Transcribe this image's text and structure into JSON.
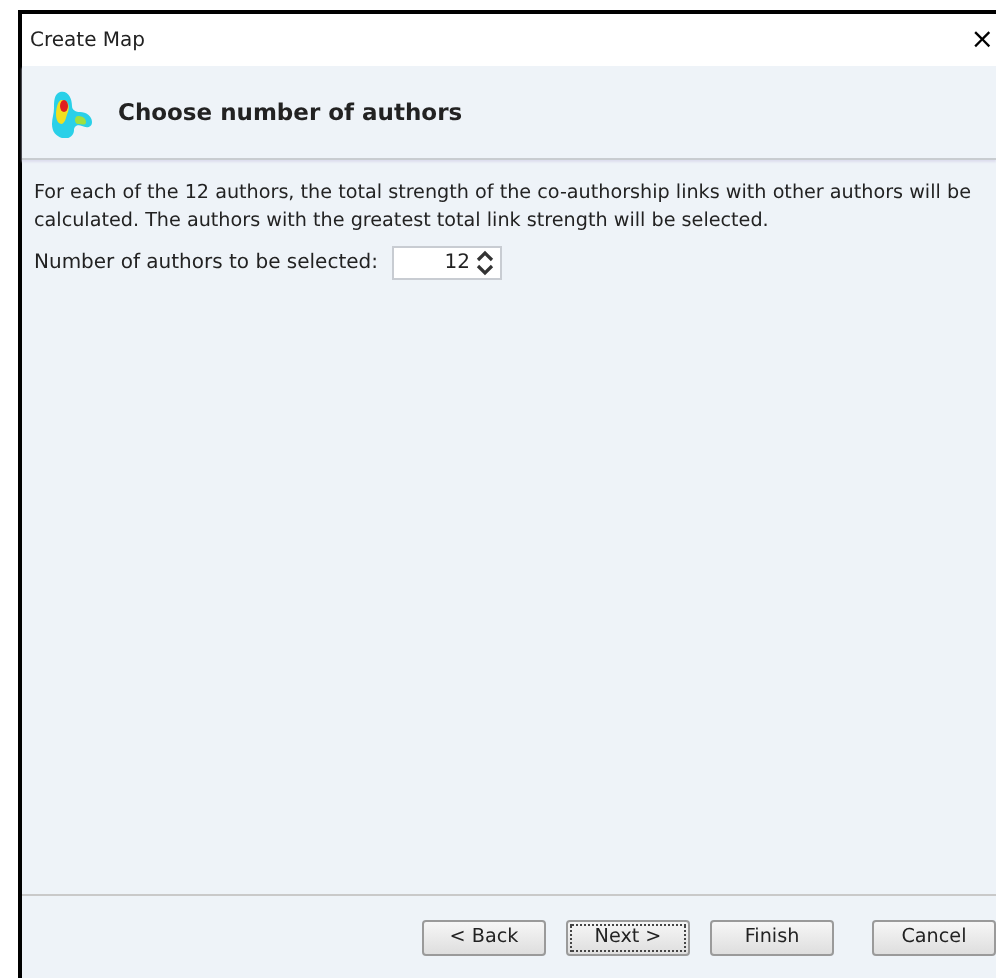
{
  "window": {
    "title": "Create Map",
    "close": "×"
  },
  "header": {
    "title": "Choose number of authors"
  },
  "description": "For each of the 12 authors, the total strength of the co-authorship links with other authors will be calculated. The authors with the greatest total link strength will be selected.",
  "field": {
    "label": "Number of authors to be selected:",
    "value": "12"
  },
  "buttons": [
    {
      "label": "< Back",
      "focused": false
    },
    {
      "label": "Next >",
      "focused": true
    },
    {
      "label": "Finish",
      "focused": false
    },
    {
      "label": "Cancel",
      "focused": false
    }
  ]
}
